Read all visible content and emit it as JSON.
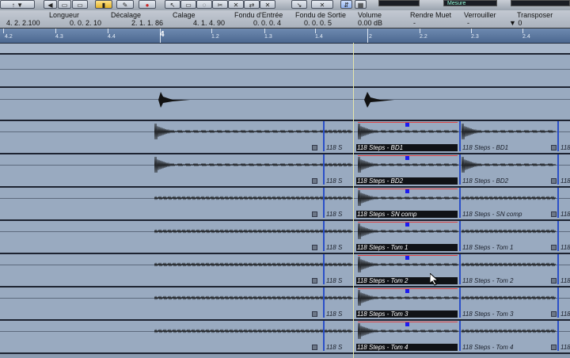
{
  "toolbar": {
    "left_dropdown": "↑ ▼",
    "mode_display": "Mesure",
    "field_right": ""
  },
  "infoline": {
    "headers": [
      "Longueur",
      "Décalage",
      "Calage",
      "Fondu d'Entrée",
      "Fondu de Sortie",
      "Volume",
      "Rendre Muet",
      "Verrouiller",
      "Transposer"
    ],
    "values": [
      "4. 2. 2.100",
      "0. 0. 2. 10",
      "2. 1. 1. 86",
      "4. 1. 4. 90",
      "0. 0. 0. 4",
      "0. 0. 0. 5",
      "0.00 dB",
      "-",
      "-",
      "▼ 0"
    ]
  },
  "ruler": {
    "labels": [
      "4.2",
      "4.3",
      "4.4",
      "4",
      "1.2",
      "1.3",
      "1.4",
      "2",
      "2.2",
      "2.3",
      "2.4"
    ],
    "current_bar": "4"
  },
  "tracks": [
    {
      "clip_labels": []
    },
    {
      "clip_labels": []
    },
    {
      "clip_labels": [
        "118 S",
        "118 Steps - BD1",
        "118 Steps - BD1",
        "118"
      ]
    },
    {
      "clip_labels": [
        "118 S",
        "118 Steps - BD2",
        "118 Steps - BD2",
        "118"
      ]
    },
    {
      "clip_labels": [
        "118 S",
        "118 Steps - SN comp",
        "118 Steps - SN comp",
        "118"
      ]
    },
    {
      "clip_labels": [
        "118 S",
        "118 Steps - Tom 1",
        "118 Steps - Tom 1",
        "118"
      ]
    },
    {
      "clip_labels": [
        "118 S",
        "118 Steps - Tom 2",
        "118 Steps - Tom 2",
        "118"
      ]
    },
    {
      "clip_labels": [
        "118 S",
        "118 Steps - Tom 3",
        "118 Steps - Tom 3",
        "118"
      ]
    },
    {
      "clip_labels": [
        "118 S",
        "118 Steps - Tom 4",
        "118 Steps - Tom 4",
        "118"
      ]
    }
  ],
  "colors": {
    "lane": "#99aac0",
    "selection_marker": "#1c1cf0",
    "boundary": "#2a4fc8"
  }
}
